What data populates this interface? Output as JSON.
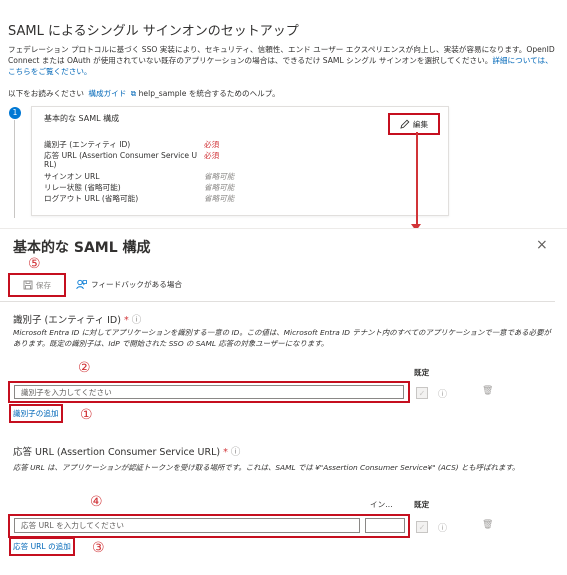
{
  "setup": {
    "title": "SAML によるシングル サインオンのセットアップ",
    "description": "フェデレーション プロトコルに基づく SSO 実装により、セキュリティ、信頼性、エンド ユーザー エクスペリエンスが向上し、実装が容易になります。OpenID Connect または OAuth が使用されていない既存のアプリケーションの場合は、できるだけ SAML シングル サインオンを選択してください。",
    "description_link": "詳細については、こちらをご覧ください。",
    "help_prefix": "以下をお読みください",
    "help_link": "構成ガイド",
    "help_suffix": "help_sample を統合するためのヘルプ。",
    "step_number": "1"
  },
  "card": {
    "title": "基本的な SAML 構成",
    "edit_label": "編集",
    "rows": [
      {
        "label": "識別子 (エンティティ ID)",
        "value": "必須",
        "required": true
      },
      {
        "label": "応答 URL (Assertion Consumer Service U",
        "label2": "RL)",
        "value": "必須",
        "required": true
      },
      {
        "label": "サインオン URL",
        "value": "省略可能",
        "required": false
      },
      {
        "label": "リレー状態 (省略可能)",
        "value": "省略可能",
        "required": false
      },
      {
        "label": "ログアウト URL (省略可能)",
        "value": "省略可能",
        "required": false
      }
    ]
  },
  "panel": {
    "title": "基本的な SAML 構成",
    "close": "×",
    "save_label": "保存",
    "feedback_label": "フィードバックがある場合",
    "markers": {
      "one": "①",
      "two": "②",
      "three": "③",
      "four": "④",
      "five": "⑤"
    },
    "identifier": {
      "label": "識別子 (エンティティ ID)",
      "required_mark": "*",
      "description": "Microsoft Entra ID に対してアプリケーションを識別する一意の ID。この値は、Microsoft Entra ID テナント内のすべてのアプリケーションで一意である必要があります。既定の識別子は、IdP で開始された SSO の SAML 応答の対象ユーザーになります。",
      "default_header": "既定",
      "placeholder": "識別子を入力してください",
      "add_link": "識別子の追加"
    },
    "reply_url": {
      "label": "応答 URL (Assertion Consumer Service URL)",
      "required_mark": "*",
      "description": "応答 URL は、アプリケーションが認証トークンを受け取る場所です。これは、SAML では ¥\"Assertion Consumer Service¥\" (ACS) とも呼ばれます。",
      "index_header": "イン…",
      "default_header": "既定",
      "placeholder": "応答 URL を入力してください",
      "add_link": "応答 URL の追加"
    }
  },
  "colors": {
    "highlight_red": "#c50f1f",
    "link_blue": "#0067b8",
    "badge_blue": "#0078d4"
  }
}
